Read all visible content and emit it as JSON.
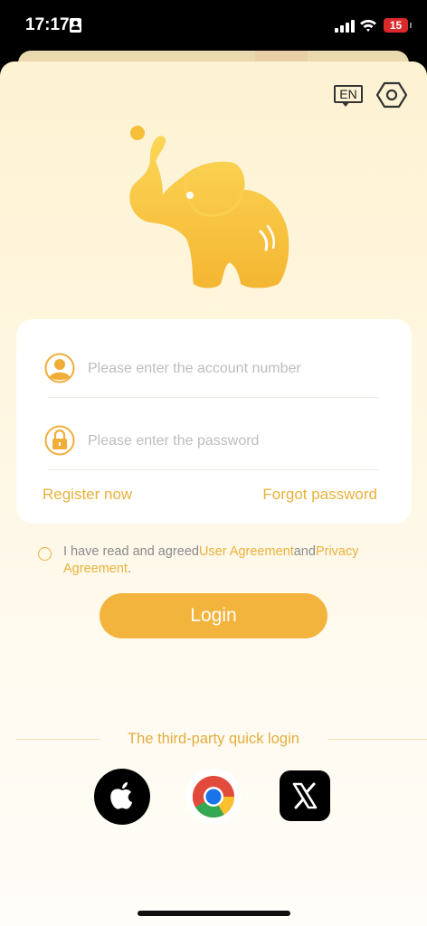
{
  "status_bar": {
    "time": "17:17",
    "battery": "15"
  },
  "header": {
    "language_label": "EN"
  },
  "login_card": {
    "account_placeholder": "Please enter the account number",
    "password_placeholder": "Please enter the password",
    "register_label": "Register now",
    "forgot_label": "Forgot password"
  },
  "agreement": {
    "prefix": "I have read and agreed",
    "user_agreement": "User Agreement",
    "and": "and",
    "privacy_agreement": "Privacy Agreement",
    "suffix": "."
  },
  "login_button": "Login",
  "third_party": {
    "title": "The third-party quick login",
    "providers": [
      "apple-icon",
      "chrome-icon",
      "x-icon"
    ]
  },
  "colors": {
    "accent": "#f2b43c",
    "link": "#e9b13a",
    "background": "#fdf2d2"
  }
}
